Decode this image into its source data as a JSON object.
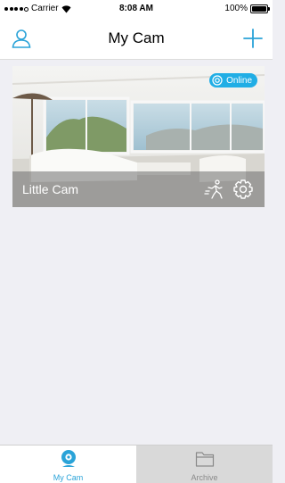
{
  "status_bar": {
    "carrier": "Carrier",
    "time": "8:08 AM",
    "battery": "100%"
  },
  "header": {
    "title": "My Cam",
    "left_icon": "user-icon",
    "right_icon": "plus-icon"
  },
  "cameras": [
    {
      "name": "Little Cam",
      "status": "Online",
      "status_icon": "camera-lens-icon",
      "actions": [
        "motion-detection-icon",
        "gear-icon"
      ]
    }
  ],
  "tabs": [
    {
      "label": "My Cam",
      "icon": "webcam-icon",
      "active": true
    },
    {
      "label": "Archive",
      "icon": "folder-icon",
      "active": false
    }
  ],
  "colors": {
    "accent": "#21aee5",
    "inactive_tab": "#d9d9d9",
    "background": "#efeff4"
  }
}
